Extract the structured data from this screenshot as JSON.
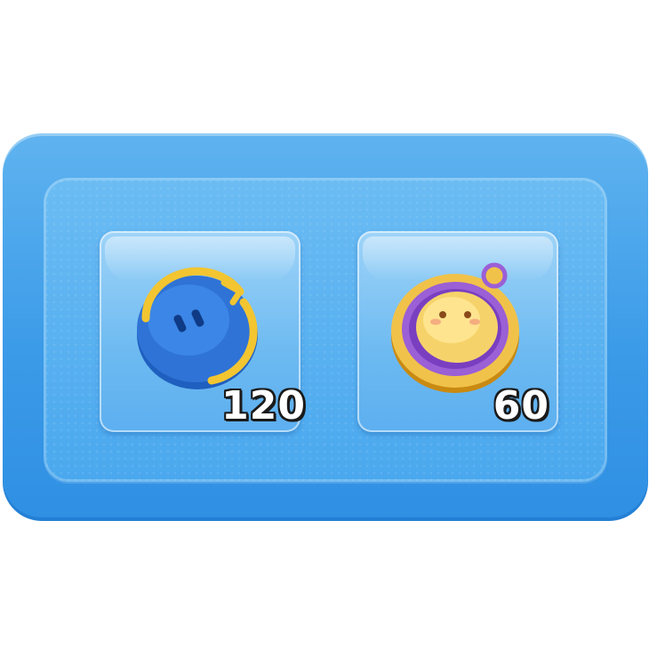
{
  "items": [
    {
      "icon": "blue-primogem-coin-icon",
      "count": "120"
    },
    {
      "icon": "gold-purple-coin-icon",
      "count": "60"
    }
  ],
  "colors": {
    "panel": "#3c9be8",
    "slot": "#6dbaf1",
    "count_text": "#ffffff",
    "count_outline": "#1a1a1a"
  }
}
